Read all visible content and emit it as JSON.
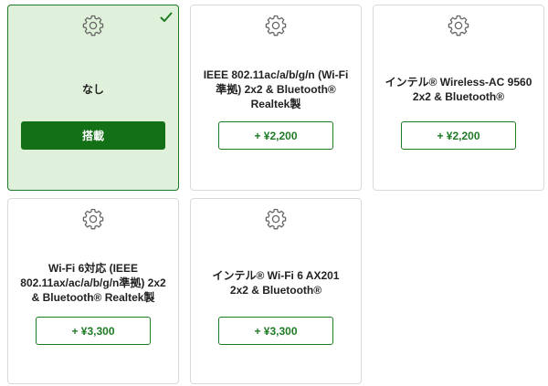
{
  "options": [
    {
      "label": "なし",
      "button": "搭載",
      "selected": true,
      "icon": "gear-icon"
    },
    {
      "label": "IEEE 802.11ac/a/b/g/n (Wi-Fi準拠) 2x2 & Bluetooth® Realtek製",
      "button": "+ ¥2,200",
      "selected": false,
      "icon": "gear-icon"
    },
    {
      "label": "インテル® Wireless-AC 9560 2x2 & Bluetooth®",
      "button": "+ ¥2,200",
      "selected": false,
      "icon": "gear-icon"
    },
    {
      "label": "Wi-Fi 6対応 (IEEE 802.11ax/ac/a/b/g/n準拠) 2x2 & Bluetooth® Realtek製",
      "button": "+ ¥3,300",
      "selected": false,
      "icon": "gear-icon"
    },
    {
      "label": "インテル® Wi-Fi 6 AX201 2x2 & Bluetooth®",
      "button": "+ ¥3,300",
      "selected": false,
      "icon": "gear-icon"
    }
  ],
  "colors": {
    "accent": "#137016",
    "selected_bg": "#dff1da",
    "border": "#d9d9d9"
  }
}
